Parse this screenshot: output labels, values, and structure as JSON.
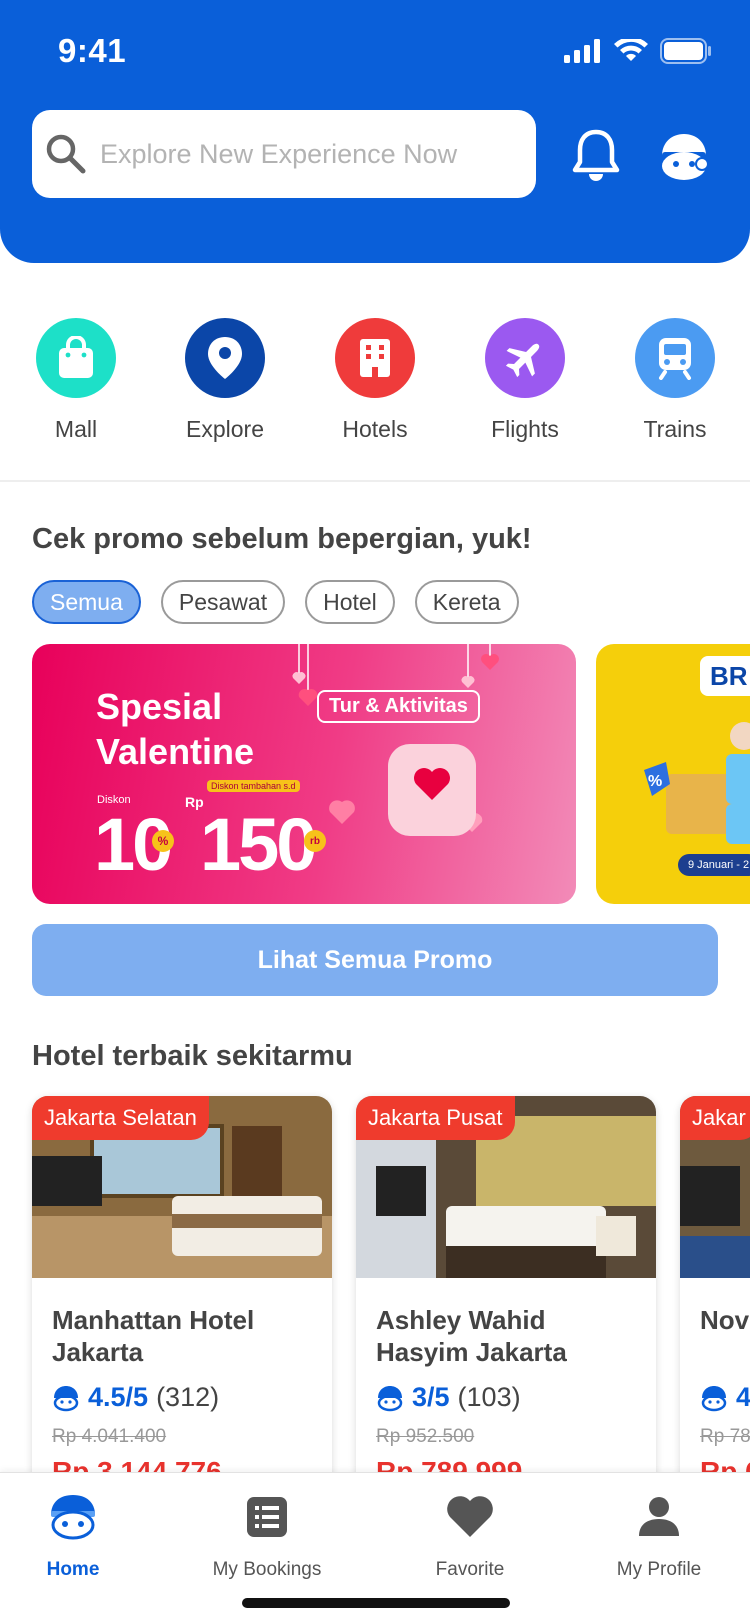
{
  "status_bar": {
    "time": "9:41"
  },
  "search": {
    "placeholder": "Explore New Experience Now"
  },
  "categories": [
    {
      "label": "Mall",
      "icon": "shopping-bag-icon",
      "color": "#1de0c8"
    },
    {
      "label": "Explore",
      "icon": "map-pin-icon",
      "color": "#0b46a8"
    },
    {
      "label": "Hotels",
      "icon": "building-icon",
      "color": "#ef3b3b"
    },
    {
      "label": "Flights",
      "icon": "airplane-icon",
      "color": "#9b59f0"
    },
    {
      "label": "Trains",
      "icon": "train-icon",
      "color": "#4b9bf2"
    }
  ],
  "promo": {
    "title": "Cek promo sebelum bepergian, yuk!",
    "chips": [
      "Semua",
      "Pesawat",
      "Hotel",
      "Kereta"
    ],
    "active_chip": "Semua",
    "banner": {
      "title_line1": "Spesial",
      "title_line2": "Valentine",
      "tag": "Tur & Aktivitas",
      "discount_label": "Diskon",
      "discount_value": "10",
      "percent_sign": "%",
      "extra_label": "Diskon tambahan s.d",
      "currency": "Rp",
      "extra_value": "150",
      "unit": "rb"
    },
    "banner2_text": "9 Januari - 2",
    "banner2_logo": "BR",
    "see_all_label": "Lihat Semua Promo"
  },
  "hotels": {
    "title": "Hotel terbaik sekitarmu",
    "items": [
      {
        "location": "Jakarta Selatan",
        "name": "Manhattan Hotel Jakarta",
        "score": "4.5/5",
        "reviews": "(312)",
        "old_price": "Rp 4.041.400",
        "price": "Rp 3.144.776"
      },
      {
        "location": "Jakarta Pusat",
        "name": "Ashley Wahid Hasyim Jakarta",
        "score": "3/5",
        "reviews": "(103)",
        "old_price": "Rp 952.500",
        "price": "Rp 789.999"
      },
      {
        "location": "Jakar",
        "name": "Nov",
        "score": "4",
        "reviews": "",
        "old_price": "Rp 78",
        "price": "Rp 6"
      }
    ]
  },
  "bottom_nav": [
    {
      "label": "Home",
      "icon": "home-mascot-icon",
      "active": true
    },
    {
      "label": "My Bookings",
      "icon": "list-icon",
      "active": false
    },
    {
      "label": "Favorite",
      "icon": "heart-icon",
      "active": false
    },
    {
      "label": "My Profile",
      "icon": "user-icon",
      "active": false
    }
  ],
  "colors": {
    "primary": "#0a5fd9",
    "price": "#e8322d",
    "chip_active": "#7eaef0"
  }
}
